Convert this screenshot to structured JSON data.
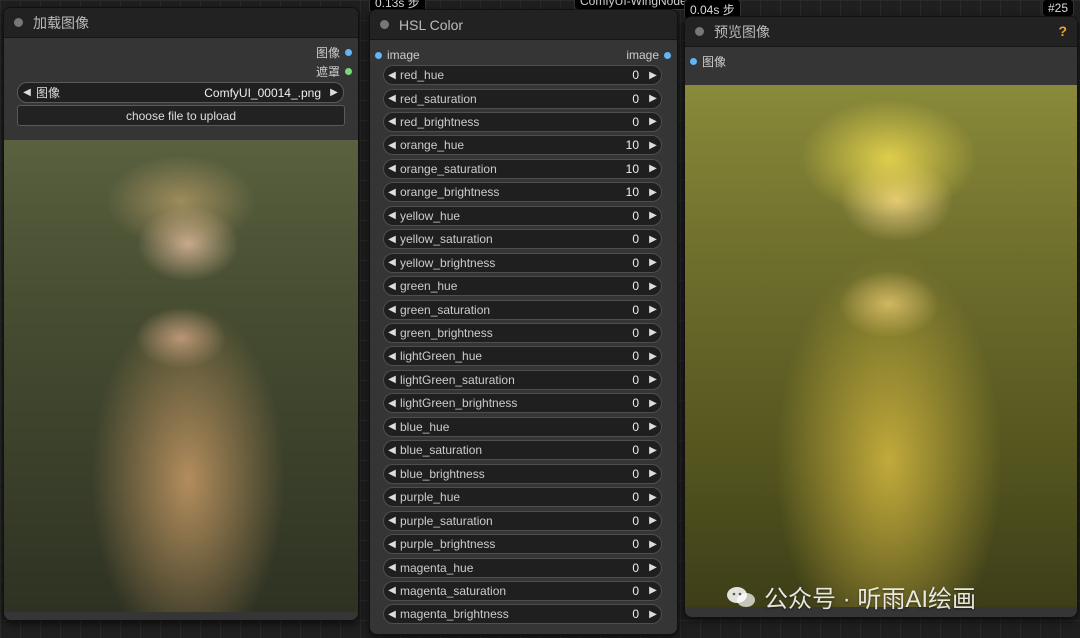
{
  "badges": {
    "time_left": "0.13s",
    "hsl_tag": "ComfyUI-WingNodes",
    "time_right": "0.04s",
    "step_suffix": "步",
    "node_id": "#25"
  },
  "load_image": {
    "title": "加载图像",
    "outputs": [
      "图像",
      "遮罩"
    ],
    "combo_label": "图像",
    "combo_value": "ComfyUI_00014_.png",
    "upload_label": "choose file to upload"
  },
  "hsl_color": {
    "title": "HSL Color",
    "input_label": "image",
    "output_label": "image",
    "params": [
      {
        "label": "red_hue",
        "value": "0"
      },
      {
        "label": "red_saturation",
        "value": "0"
      },
      {
        "label": "red_brightness",
        "value": "0"
      },
      {
        "label": "orange_hue",
        "value": "10"
      },
      {
        "label": "orange_saturation",
        "value": "10"
      },
      {
        "label": "orange_brightness",
        "value": "10"
      },
      {
        "label": "yellow_hue",
        "value": "0"
      },
      {
        "label": "yellow_saturation",
        "value": "0"
      },
      {
        "label": "yellow_brightness",
        "value": "0"
      },
      {
        "label": "green_hue",
        "value": "0"
      },
      {
        "label": "green_saturation",
        "value": "0"
      },
      {
        "label": "green_brightness",
        "value": "0"
      },
      {
        "label": "lightGreen_hue",
        "value": "0"
      },
      {
        "label": "lightGreen_saturation",
        "value": "0"
      },
      {
        "label": "lightGreen_brightness",
        "value": "0"
      },
      {
        "label": "blue_hue",
        "value": "0"
      },
      {
        "label": "blue_saturation",
        "value": "0"
      },
      {
        "label": "blue_brightness",
        "value": "0"
      },
      {
        "label": "purple_hue",
        "value": "0"
      },
      {
        "label": "purple_saturation",
        "value": "0"
      },
      {
        "label": "purple_brightness",
        "value": "0"
      },
      {
        "label": "magenta_hue",
        "value": "0"
      },
      {
        "label": "magenta_saturation",
        "value": "0"
      },
      {
        "label": "magenta_brightness",
        "value": "0"
      }
    ]
  },
  "preview": {
    "title": "预览图像",
    "input_label": "图像",
    "help": "?"
  },
  "watermark": {
    "text": "公众号 · 听雨AI绘画"
  },
  "colors": {
    "socket_image": "#64b5f6",
    "socket_mask": "#7bd77b",
    "help_icon": "#f0a030"
  }
}
